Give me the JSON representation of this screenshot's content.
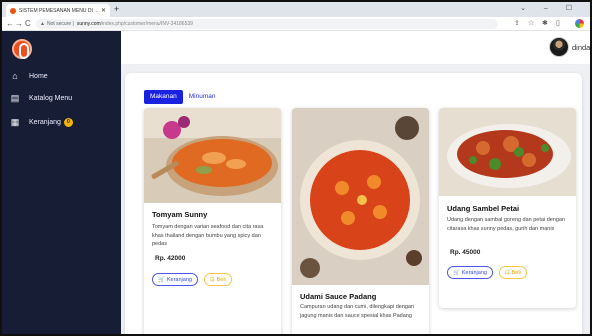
{
  "browser": {
    "tab_title": "SISTEM PEMESANAN MENU DI ...",
    "tab_close": "✕",
    "new_tab": "+",
    "window_controls": "⌄ – ☐",
    "back": "←",
    "forward": "→",
    "reload": "C",
    "security_icon": "▲",
    "not_secure": "Not secure |",
    "url_host": "sunny.com",
    "url_path": "/index.php/customer/menu/INV-34186539",
    "ext_icons": [
      "⇪",
      "☆",
      "✱",
      "▯"
    ]
  },
  "sidebar": {
    "items": [
      {
        "label": "Home",
        "icon": "home-icon"
      },
      {
        "label": "Katalog Menu",
        "icon": "catalog-icon"
      },
      {
        "label": "Keranjang",
        "icon": "cart-icon",
        "badge": "0"
      }
    ]
  },
  "user": {
    "name": "dinda",
    "chevron": "⌄"
  },
  "tabs": {
    "active": "Makanan",
    "inactive": "Minuman"
  },
  "cards": [
    {
      "title": "Tomyam Sunny",
      "desc": "Tomyam dengan varian seafood dan cita rasa khas thailand dengan bumbu yang spicy dan pedas",
      "price": "Rp. 42000",
      "cart": "Keranjang",
      "buy": "Beli"
    },
    {
      "title": "Udami Sauce Padang",
      "desc": "Campuran udang dan cumi, dilengkapi dengan jagung manis dan sauce spesial khas Padang"
    },
    {
      "title": "Udang Sambel Petai",
      "desc": "Udang dengan sambal goreng dan petai dengan citarasa khas sunny pedas, gurih dan manis",
      "price": "Rp. 45000",
      "cart": "Keranjang",
      "buy": "Beli"
    }
  ],
  "colors": {
    "sidebar_bg": "#161d35",
    "accent": "#1a22e0",
    "badge": "#f5b400",
    "buy": "#f5c54a"
  }
}
